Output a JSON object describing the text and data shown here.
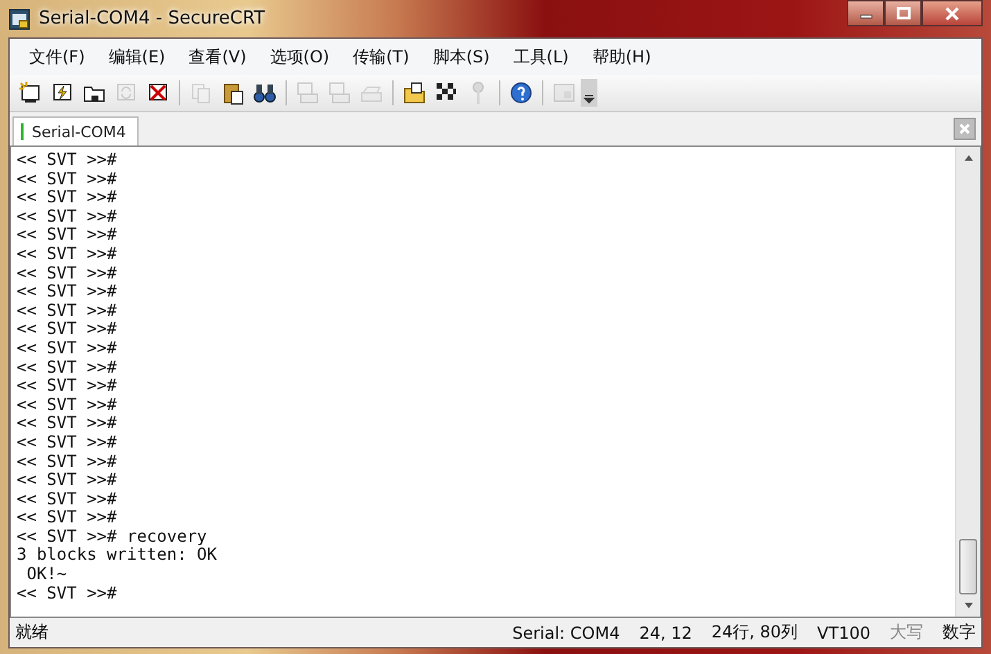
{
  "window": {
    "title": "Serial-COM4 - SecureCRT"
  },
  "menu": [
    {
      "label": "文件(F)"
    },
    {
      "label": "编辑(E)"
    },
    {
      "label": "查看(V)"
    },
    {
      "label": "选项(O)"
    },
    {
      "label": "传输(T)"
    },
    {
      "label": "脚本(S)"
    },
    {
      "label": "工具(L)"
    },
    {
      "label": "帮助(H)"
    }
  ],
  "toolbar": [
    {
      "kind": "connect",
      "disabled": false
    },
    {
      "kind": "quick",
      "disabled": false
    },
    {
      "kind": "folder",
      "disabled": false
    },
    {
      "kind": "reconnect",
      "disabled": true
    },
    {
      "kind": "disconnect",
      "disabled": false
    },
    {
      "kind": "sep"
    },
    {
      "kind": "copy",
      "disabled": true
    },
    {
      "kind": "paste",
      "disabled": false
    },
    {
      "kind": "find",
      "disabled": false
    },
    {
      "kind": "sep"
    },
    {
      "kind": "print",
      "disabled": true
    },
    {
      "kind": "print",
      "disabled": true
    },
    {
      "kind": "printer",
      "disabled": true
    },
    {
      "kind": "sep"
    },
    {
      "kind": "options",
      "disabled": false
    },
    {
      "kind": "keymap",
      "disabled": false
    },
    {
      "kind": "key",
      "disabled": true
    },
    {
      "kind": "sep"
    },
    {
      "kind": "help",
      "disabled": false
    },
    {
      "kind": "sep"
    },
    {
      "kind": "window",
      "disabled": true
    }
  ],
  "tabs": [
    {
      "label": "Serial-COM4",
      "selected": true
    }
  ],
  "terminal": {
    "lines": [
      "<< SVT >>#",
      "<< SVT >>#",
      "<< SVT >>#",
      "<< SVT >>#",
      "<< SVT >>#",
      "<< SVT >>#",
      "<< SVT >>#",
      "<< SVT >>#",
      "<< SVT >>#",
      "<< SVT >>#",
      "<< SVT >>#",
      "<< SVT >>#",
      "<< SVT >>#",
      "<< SVT >>#",
      "<< SVT >>#",
      "<< SVT >>#",
      "<< SVT >>#",
      "<< SVT >>#",
      "<< SVT >>#",
      "<< SVT >>#",
      "<< SVT >># recovery",
      "3 blocks written: OK",
      " OK!~",
      "<< SVT >>#"
    ]
  },
  "status_bar": {
    "message": "就绪",
    "fields": [
      {
        "text": "Serial: COM4",
        "disabled": false
      },
      {
        "text": "24,  12",
        "disabled": false
      },
      {
        "text": "24行, 80列",
        "disabled": false
      },
      {
        "text": "VT100",
        "disabled": false
      },
      {
        "text": "大写",
        "disabled": true
      },
      {
        "text": "数字",
        "disabled": false
      }
    ]
  }
}
